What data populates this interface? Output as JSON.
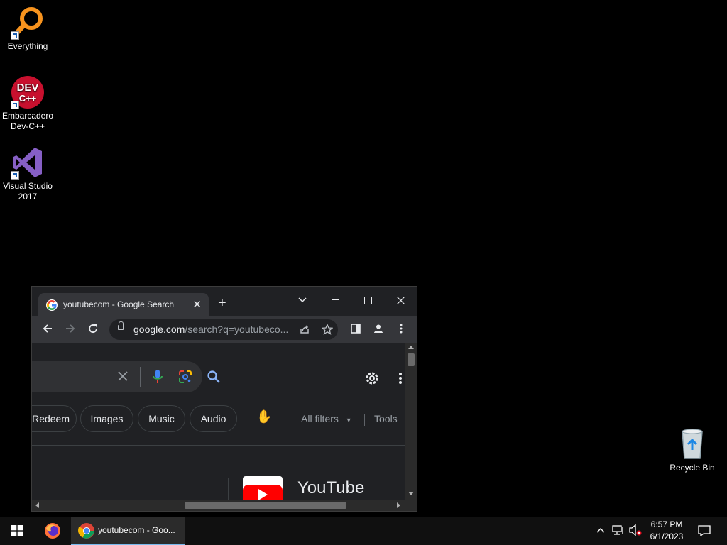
{
  "desktop": {
    "icons": [
      {
        "label": "Everything"
      },
      {
        "label": "Embarcadero Dev-C++",
        "line1": "Embarcadero",
        "line2": "Dev-C++",
        "logo_text": "DEV C++"
      },
      {
        "label": "Visual Studio 2017",
        "line1": "Visual Studio",
        "line2": "2017"
      },
      {
        "label": "Recycle Bin"
      }
    ]
  },
  "browser": {
    "tab_title": "youtubecom - Google Search",
    "new_tab_label": "+",
    "url_domain": "google.com",
    "url_rest": "/search?q=youtubeco...",
    "chips": [
      "Redeem",
      "Images",
      "Music",
      "Audio"
    ],
    "all_filters_label": "All filters",
    "tools_label": "Tools",
    "result_title": "YouTube"
  },
  "taskbar": {
    "chrome_label": "youtubecom - Goo...",
    "time": "6:57 PM",
    "date": "6/1/2023"
  },
  "colors": {
    "accent_blue": "#8ab4f8",
    "youtube_red": "#ff0000",
    "taskbar_active": "#76b9ed"
  }
}
